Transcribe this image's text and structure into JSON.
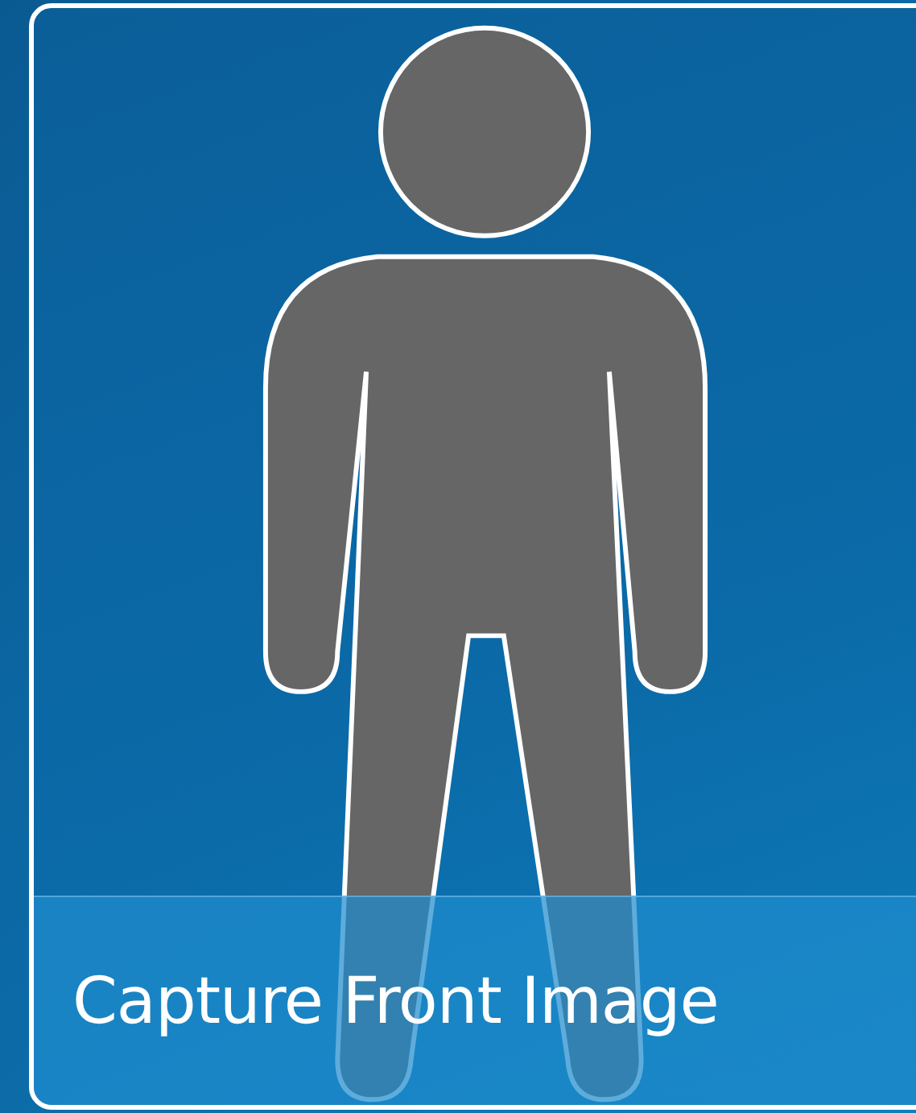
{
  "button": {
    "label": "Capture Front Image"
  }
}
